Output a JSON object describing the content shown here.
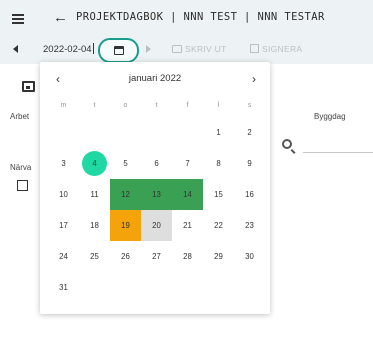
{
  "header": {
    "title": "PROJEKTDAGBOK | NNN TEST | NNN TESTAR",
    "menu_icon": "hamburger-menu-icon",
    "back_icon": "arrow-left-icon"
  },
  "toolbar": {
    "date_value": "2022-02-04",
    "print_label": "SKRIV UT",
    "sign_label": "SIGNERA",
    "highlight_color": "#1a9e8c"
  },
  "background": {
    "arbet_label": "Arbet",
    "byggdag_label": "Byggdag",
    "narvaro_label": "Närva"
  },
  "calendar": {
    "month_label": "januari 2022",
    "weekdays": [
      "m",
      "t",
      "o",
      "t",
      "f",
      "l",
      "s"
    ],
    "leading_blanks": 5,
    "days": [
      {
        "d": "1",
        "s": ""
      },
      {
        "d": "2",
        "s": ""
      },
      {
        "d": "3",
        "s": ""
      },
      {
        "d": "4",
        "s": "today"
      },
      {
        "d": "5",
        "s": ""
      },
      {
        "d": "6",
        "s": ""
      },
      {
        "d": "7",
        "s": ""
      },
      {
        "d": "8",
        "s": ""
      },
      {
        "d": "9",
        "s": ""
      },
      {
        "d": "10",
        "s": ""
      },
      {
        "d": "11",
        "s": ""
      },
      {
        "d": "12",
        "s": "green"
      },
      {
        "d": "13",
        "s": "green"
      },
      {
        "d": "14",
        "s": "green"
      },
      {
        "d": "15",
        "s": ""
      },
      {
        "d": "16",
        "s": ""
      },
      {
        "d": "17",
        "s": ""
      },
      {
        "d": "18",
        "s": ""
      },
      {
        "d": "19",
        "s": "orange"
      },
      {
        "d": "20",
        "s": "grey"
      },
      {
        "d": "21",
        "s": ""
      },
      {
        "d": "22",
        "s": ""
      },
      {
        "d": "23",
        "s": ""
      },
      {
        "d": "24",
        "s": ""
      },
      {
        "d": "25",
        "s": ""
      },
      {
        "d": "26",
        "s": ""
      },
      {
        "d": "27",
        "s": ""
      },
      {
        "d": "28",
        "s": ""
      },
      {
        "d": "29",
        "s": ""
      },
      {
        "d": "30",
        "s": ""
      },
      {
        "d": "31",
        "s": ""
      }
    ],
    "colors": {
      "today": "#1fd8a4",
      "green": "#3aa053",
      "orange": "#f5a30a",
      "grey": "#dedede"
    }
  }
}
